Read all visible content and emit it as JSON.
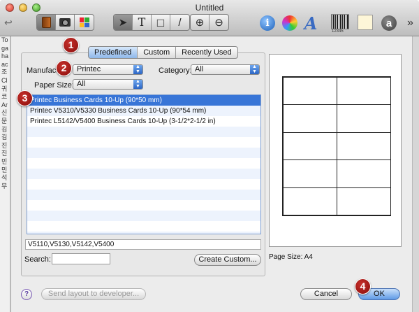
{
  "window": {
    "title": "Untitled",
    "back_glyph": "↩"
  },
  "toolbar": {
    "tool_glyphs": [
      "➤",
      "T",
      "□",
      "/"
    ],
    "zoom_glyphs": [
      "⊕",
      "⊖"
    ],
    "info_glyph": "i",
    "font_glyph": "A",
    "barcode_digits": "12345",
    "account_glyph": "a",
    "more_glyph": "»"
  },
  "background_strip": {
    "items": [
      "To",
      "ga",
      "ha",
      "ac",
      "조",
      "Cl",
      "귀",
      "코",
      "Ar",
      "신",
      "문",
      "김",
      "김",
      "진",
      "진",
      "민",
      "민",
      "석",
      "무"
    ]
  },
  "tabs": [
    {
      "label": "Predefined",
      "selected": true
    },
    {
      "label": "Custom",
      "selected": false
    },
    {
      "label": "Recently Used",
      "selected": false
    }
  ],
  "filters": {
    "manufacturer_label": "Manufactu",
    "manufacturer_value": "Printec",
    "category_label": "Category:",
    "category_value": "All",
    "paper_size_label": "Paper Size:",
    "paper_size_value": "All"
  },
  "layouts": [
    {
      "label": "Printec Business Cards 10-Up (90*50 mm)",
      "selected": true
    },
    {
      "label": "Printec V5310/V5330 Business Cards 10-Up (90*54 mm)",
      "selected": false
    },
    {
      "label": "Printec L5142/V5400 Business Cards 10-Up (3-1/2*2-1/2 in)",
      "selected": false
    }
  ],
  "models_text": "V5110,V5130,V5142,V5400",
  "search": {
    "label": "Search:",
    "value": ""
  },
  "buttons": {
    "create_custom": "Create Custom...",
    "send_layout": "Send layout to developer...",
    "cancel": "Cancel",
    "ok": "OK",
    "help": "?"
  },
  "preview": {
    "page_size_label": "Page Size: A4",
    "columns": 2,
    "rows": 5
  },
  "callouts": [
    "1",
    "2",
    "3",
    "4"
  ],
  "colors": {
    "selection": "#3875d7",
    "callout": "#b01a17"
  }
}
